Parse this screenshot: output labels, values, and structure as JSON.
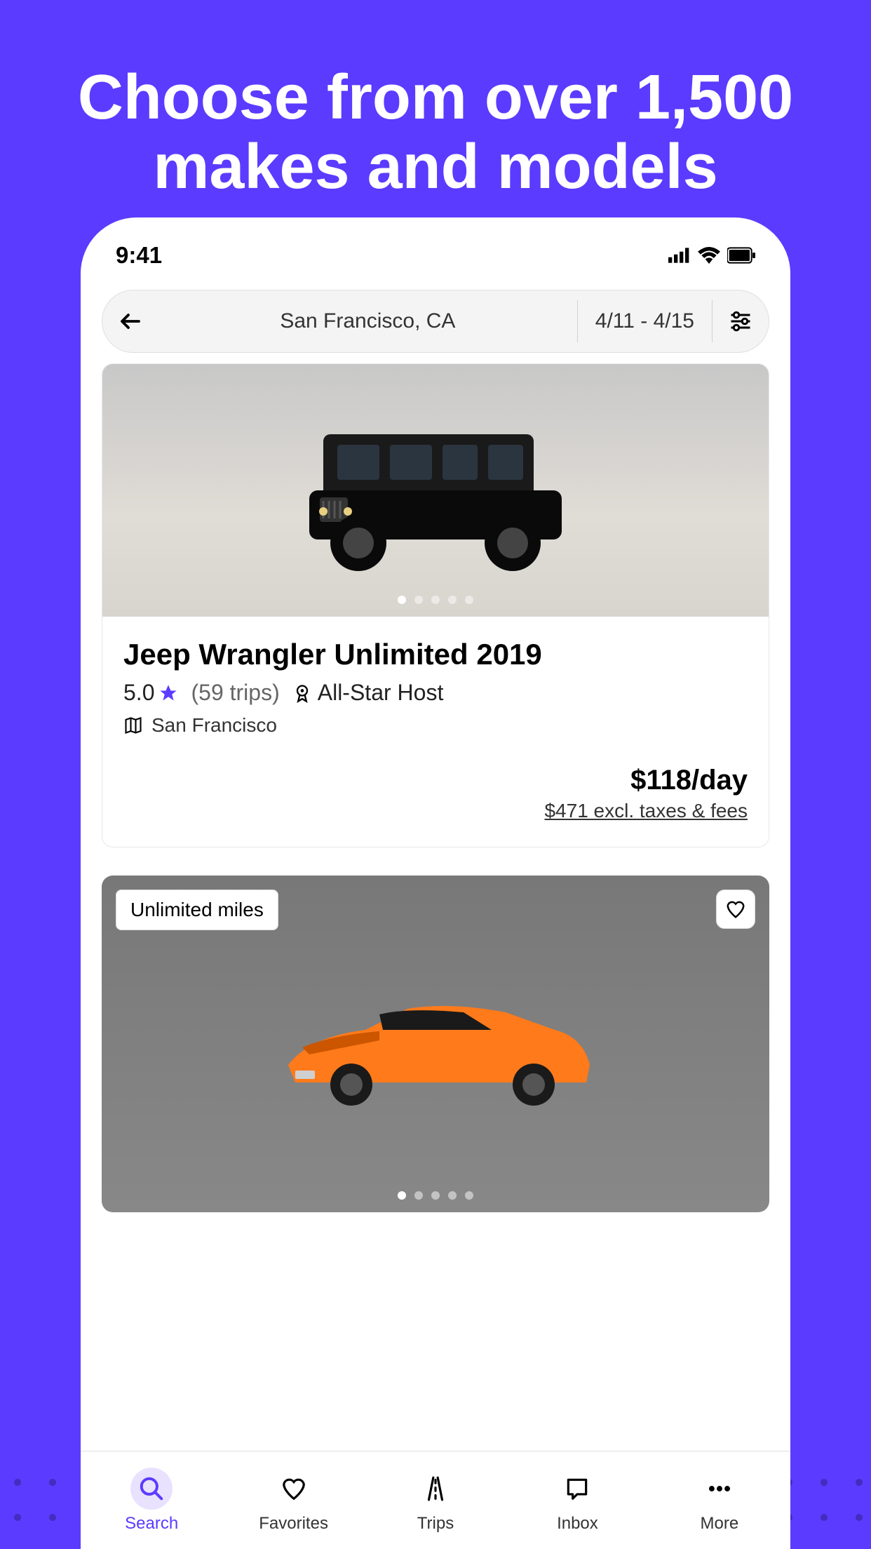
{
  "marketing": {
    "headline": "Choose from over 1,500 makes and models"
  },
  "statusbar": {
    "time": "9:41"
  },
  "search": {
    "location": "San Francisco, CA",
    "dates": "4/11 - 4/15"
  },
  "listing1": {
    "title": "Jeep Wrangler Unlimited 2019",
    "rating": "5.0",
    "trips": "(59 trips)",
    "host_badge": "All-Star Host",
    "location": "San Francisco",
    "price": "$118/day",
    "price_sub": "$471 excl. taxes & fees"
  },
  "listing2": {
    "badge": "Unlimited miles"
  },
  "nav": {
    "search": "Search",
    "favorites": "Favorites",
    "trips": "Trips",
    "inbox": "Inbox",
    "more": "More"
  }
}
